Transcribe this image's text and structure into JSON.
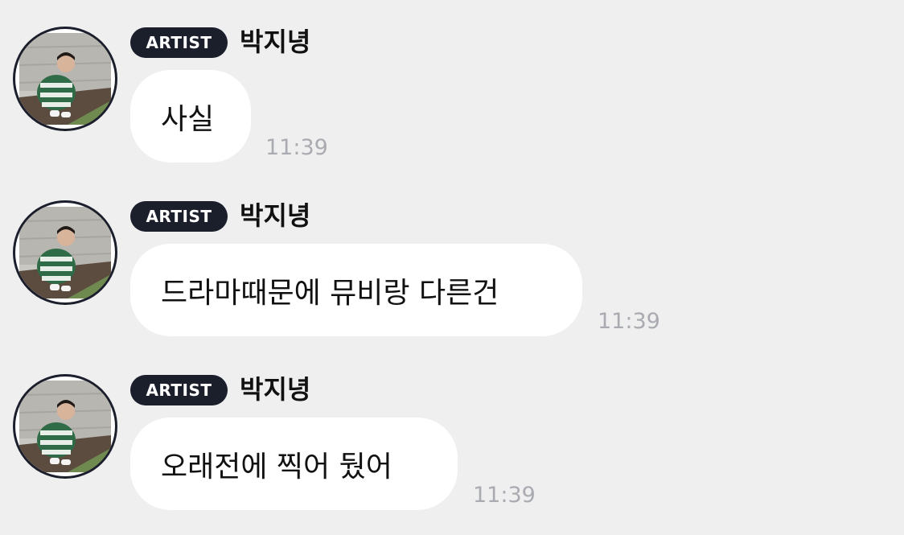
{
  "messages": [
    {
      "badge": "ARTIST",
      "sender": "박지녕",
      "text": "사실",
      "time": "11:39"
    },
    {
      "badge": "ARTIST",
      "sender": "박지녕",
      "text": "드라마때문에 뮤비랑 다른건",
      "time": "11:39"
    },
    {
      "badge": "ARTIST",
      "sender": "박지녕",
      "text": "오래전에 찍어 뒀어",
      "time": "11:39"
    }
  ],
  "colors": {
    "background": "#efeff0",
    "badge": "#1b1e2b",
    "bubble": "#ffffff",
    "timestamp": "#a9abb1"
  },
  "icons": {
    "avatar": "artist-profile-photo"
  }
}
